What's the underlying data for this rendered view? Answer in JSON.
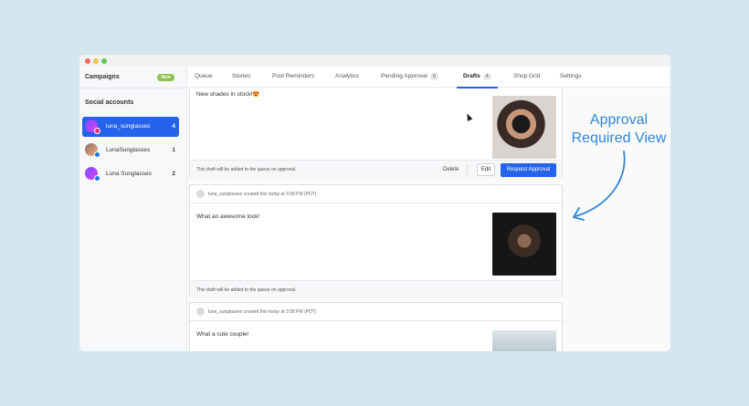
{
  "sidebar": {
    "campaigns_label": "Campaigns",
    "new_badge": "New",
    "social_title": "Social accounts",
    "accounts": [
      {
        "name": "luna_sunglasses",
        "count": "4"
      },
      {
        "name": "LunaSunglasses",
        "count": "1"
      },
      {
        "name": "Luna Sunglasses",
        "count": "2"
      }
    ]
  },
  "nav": {
    "tabs": [
      {
        "label": "Queue"
      },
      {
        "label": "Stories"
      },
      {
        "label": "Post Reminders"
      },
      {
        "label": "Analytics"
      },
      {
        "label": "Pending Approval",
        "count": "0"
      },
      {
        "label": "Drafts",
        "count": "4"
      },
      {
        "label": "Shop Grid"
      },
      {
        "label": "Settings"
      }
    ]
  },
  "posts": [
    {
      "caption": "New shades in stock!😍",
      "footer_note": "This draft will be added to the queue on approval.",
      "delete_label": "Delete",
      "edit_label": "Edit",
      "request_label": "Request Approval"
    },
    {
      "meta": "luna_sunglasses created this today at 3:58 PM (PDT)",
      "caption": "What an awesome look!",
      "footer_note": "This draft will be added to the queue on approval."
    },
    {
      "meta": "luna_sunglasses created this today at 3:58 PM (PDT)",
      "caption": "What a cute couple!"
    }
  ],
  "annotation": {
    "line1": "Approval",
    "line2": "Required View"
  },
  "colors": {
    "accent": "#2563eb",
    "background": "#d4e6ee",
    "annotation": "#2f86d6",
    "new_badge": "#8bc34a"
  }
}
